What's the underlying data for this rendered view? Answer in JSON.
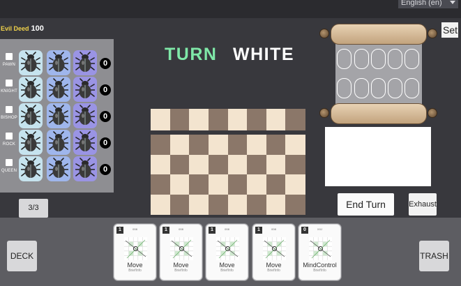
{
  "header": {
    "language": "English (en)"
  },
  "evil_deed": {
    "label": "Evil Deed",
    "value": "100"
  },
  "pieces_panel": {
    "rows": [
      {
        "label": "PAWN",
        "count": "0"
      },
      {
        "label": "KNIGHT",
        "count": "0"
      },
      {
        "label": "BISHOP",
        "count": "0"
      },
      {
        "label": "ROCK",
        "count": "0"
      },
      {
        "label": "QUEEN",
        "count": "0"
      }
    ],
    "page_indicator": "3/3"
  },
  "turn": {
    "label": "TURN",
    "player": "WHITE"
  },
  "buttons": {
    "set": "Set",
    "end_turn": "End Turn",
    "exhaust": "Exhaust",
    "deck": "DECK",
    "trash": "TRASH"
  },
  "hand": [
    {
      "cost": "1",
      "code": "008",
      "name": "Move",
      "info": "BriefInfo"
    },
    {
      "cost": "1",
      "code": "008",
      "name": "Move",
      "info": "BriefInfo"
    },
    {
      "cost": "1",
      "code": "008",
      "name": "Move",
      "info": "BriefInfo"
    },
    {
      "cost": "1",
      "code": "008",
      "name": "Move",
      "info": "BriefInfo"
    },
    {
      "cost": "0",
      "code": "XXJ",
      "name": "MindControl",
      "info": "BriefInfo"
    }
  ],
  "colors": {
    "background": "#38383d",
    "turn_label": "#7fe8a8",
    "evil_deed_label": "#f0d24a",
    "board_light": "#f3e4cf",
    "board_dark": "#8b7769"
  }
}
